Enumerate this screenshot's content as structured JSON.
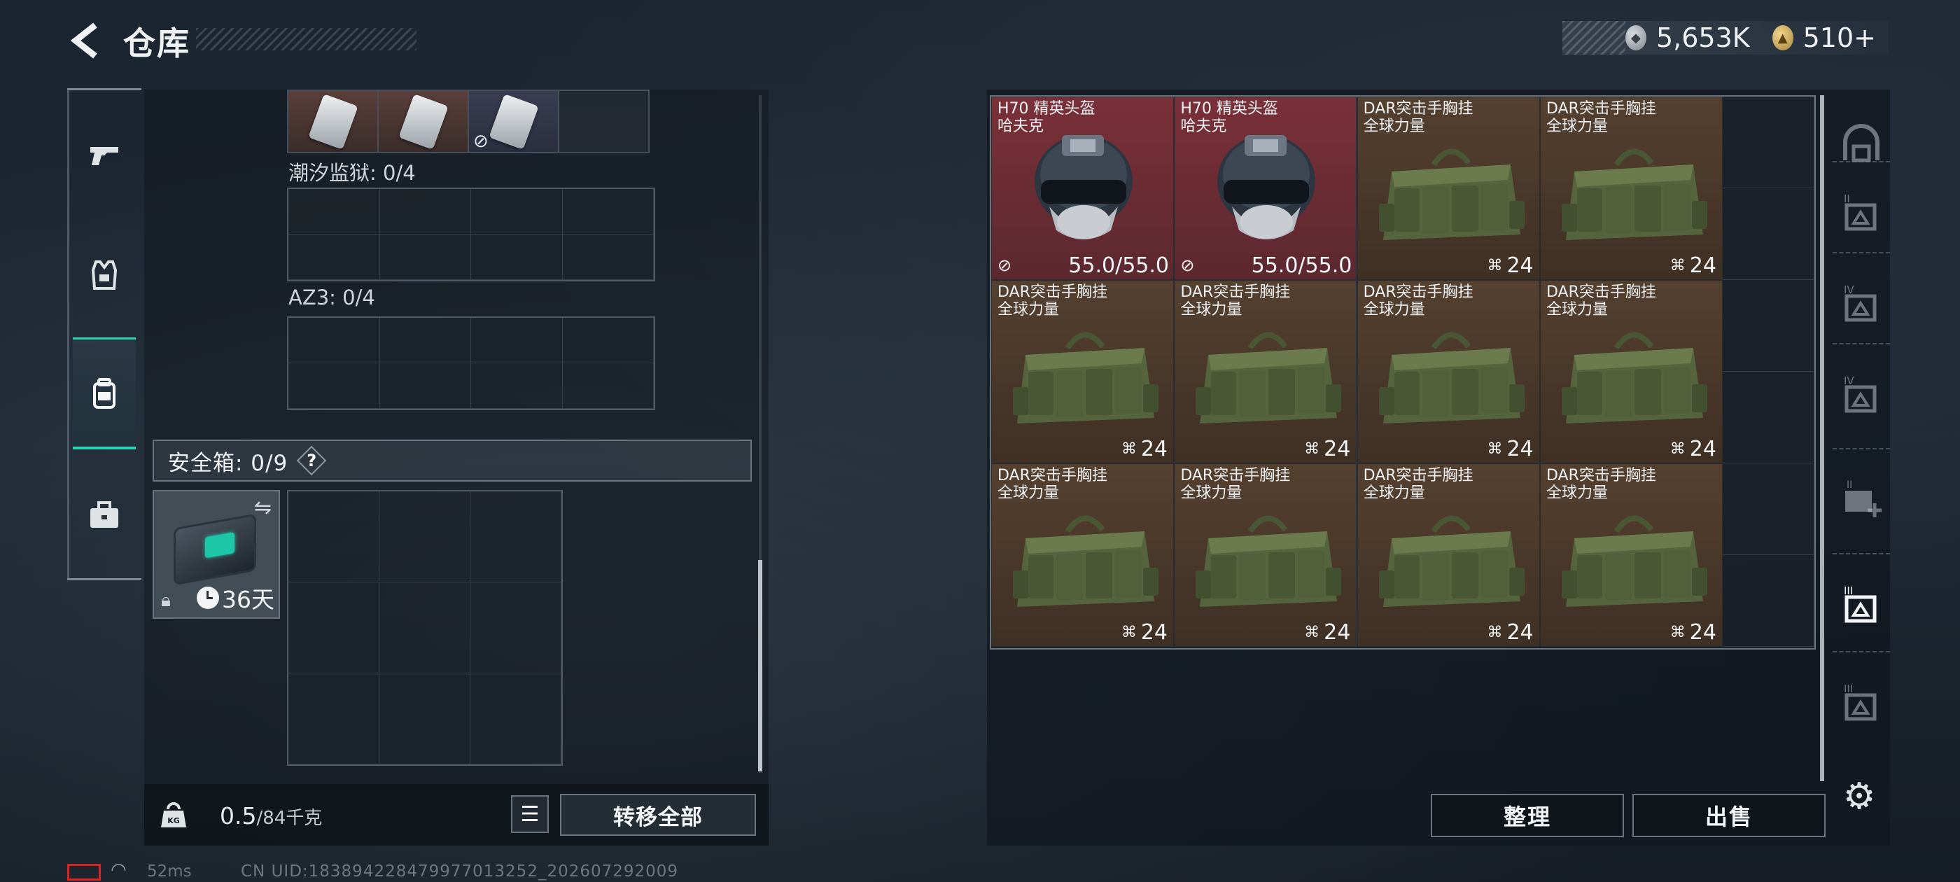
{
  "header": {
    "title": "仓库",
    "currency": [
      {
        "icon": "silver-coin-icon",
        "value": "5,653K"
      },
      {
        "icon": "gold-coin-icon",
        "value": "510",
        "suffix": "+"
      }
    ]
  },
  "left_rail": {
    "tabs": [
      {
        "name": "weapons",
        "icon": "pistol-icon",
        "active": false
      },
      {
        "name": "armor",
        "icon": "vest-icon",
        "active": false
      },
      {
        "name": "backpack",
        "icon": "backpack-icon",
        "active": true
      },
      {
        "name": "medical",
        "icon": "toolbox-icon",
        "active": false
      }
    ],
    "accent_color": "#2ed3b6"
  },
  "loadout": {
    "keycards_row": {
      "count": 3,
      "last_no_trade": true
    },
    "sections": [
      {
        "label": "潮汐监狱: 0/4"
      },
      {
        "label": "AZ3: 0/4"
      }
    ],
    "safe_box": {
      "label": "安全箱:  0/9",
      "help": "?",
      "days": "36天"
    },
    "weight": {
      "current": "0.5",
      "max": "/84千克",
      "icon_label": "KG"
    },
    "transfer_all": "转移全部"
  },
  "stash": {
    "items": [
      {
        "type": "helmet",
        "name": "H70 精英头盔\n哈夫克",
        "durability": "55.0/55.0"
      },
      {
        "type": "helmet",
        "name": "H70 精英头盔\n哈夫克",
        "durability": "55.0/55.0"
      },
      {
        "type": "rig",
        "name": "DAR突击手胸挂\n全球力量",
        "count": "24"
      },
      {
        "type": "rig",
        "name": "DAR突击手胸挂\n全球力量",
        "count": "24"
      },
      {
        "type": "rig",
        "name": "DAR突击手胸挂\n全球力量",
        "count": "24"
      },
      {
        "type": "rig",
        "name": "DAR突击手胸挂\n全球力量",
        "count": "24"
      },
      {
        "type": "rig",
        "name": "DAR突击手胸挂\n全球力量",
        "count": "24"
      },
      {
        "type": "rig",
        "name": "DAR突击手胸挂\n全球力量",
        "count": "24"
      },
      {
        "type": "rig",
        "name": "DAR突击手胸挂\n全球力量",
        "count": "24"
      },
      {
        "type": "rig",
        "name": "DAR突击手胸挂\n全球力量",
        "count": "24"
      },
      {
        "type": "rig",
        "name": "DAR突击手胸挂\n全球力量",
        "count": "24"
      },
      {
        "type": "rig",
        "name": "DAR突击手胸挂\n全球力量",
        "count": "24"
      }
    ],
    "sort_label": "整理",
    "sell_label": "出售"
  },
  "right_rail": {
    "tabs": [
      {
        "icon": "stash-overview-icon",
        "roman": ""
      },
      {
        "icon": "stash-page-icon",
        "roman": "II"
      },
      {
        "icon": "stash-page-icon",
        "roman": "IV"
      },
      {
        "icon": "stash-page-icon",
        "roman": "IV"
      },
      {
        "icon": "stash-add-icon",
        "roman": "II"
      },
      {
        "icon": "stash-page-icon",
        "roman": "III",
        "active": true
      },
      {
        "icon": "stash-page-icon",
        "roman": "III"
      }
    ]
  },
  "status_bar": {
    "ping": "52ms",
    "uid": "CN UID:183894228479977013252_202607292009"
  },
  "colors": {
    "helmet_bg": "#7a3038",
    "rig_bg": "#55402f",
    "battery_low": "#d82424"
  }
}
